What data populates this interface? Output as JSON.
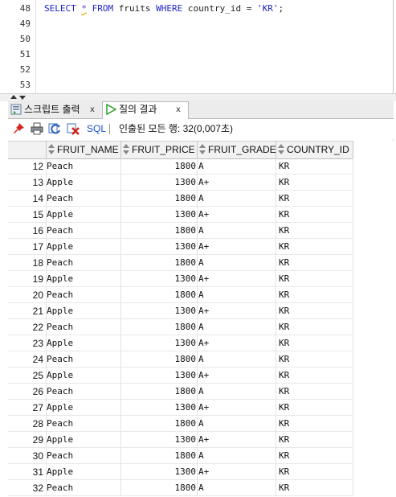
{
  "editor": {
    "line_numbers": [
      "48",
      "49",
      "50",
      "51",
      "52",
      "53"
    ],
    "code": {
      "kw_select": "SELECT",
      "star": "*",
      "kw_from": "FROM",
      "table": "fruits",
      "kw_where": "WHERE",
      "column": "country_id",
      "op": "=",
      "literal": "'KR'",
      "semicolon": ";"
    }
  },
  "tabs": [
    {
      "label": "스크립트 출력",
      "close": "x",
      "icon": "script-output-icon"
    },
    {
      "label": "질의 결과",
      "close": "x",
      "icon": "run-query-icon",
      "active": true
    }
  ],
  "toolbar": {
    "sql_label": "SQL",
    "status": "인출된 모든 행: 32(0,007초)",
    "icons": [
      "pin-icon",
      "print-icon",
      "refresh-icon",
      "clear-icon"
    ]
  },
  "grid": {
    "columns": [
      "FRUIT_NAME",
      "FRUIT_PRICE",
      "FRUIT_GRADE",
      "COUNTRY_ID"
    ],
    "rows": [
      {
        "n": "12",
        "name": "Peach",
        "price": "1800",
        "grade": "A",
        "cid": "KR"
      },
      {
        "n": "13",
        "name": "Apple",
        "price": "1300",
        "grade": "A+",
        "cid": "KR"
      },
      {
        "n": "14",
        "name": "Peach",
        "price": "1800",
        "grade": "A",
        "cid": "KR"
      },
      {
        "n": "15",
        "name": "Apple",
        "price": "1300",
        "grade": "A+",
        "cid": "KR"
      },
      {
        "n": "16",
        "name": "Peach",
        "price": "1800",
        "grade": "A",
        "cid": "KR"
      },
      {
        "n": "17",
        "name": "Apple",
        "price": "1300",
        "grade": "A+",
        "cid": "KR"
      },
      {
        "n": "18",
        "name": "Peach",
        "price": "1800",
        "grade": "A",
        "cid": "KR"
      },
      {
        "n": "19",
        "name": "Apple",
        "price": "1300",
        "grade": "A+",
        "cid": "KR"
      },
      {
        "n": "20",
        "name": "Peach",
        "price": "1800",
        "grade": "A",
        "cid": "KR"
      },
      {
        "n": "21",
        "name": "Apple",
        "price": "1300",
        "grade": "A+",
        "cid": "KR"
      },
      {
        "n": "22",
        "name": "Peach",
        "price": "1800",
        "grade": "A",
        "cid": "KR"
      },
      {
        "n": "23",
        "name": "Apple",
        "price": "1300",
        "grade": "A+",
        "cid": "KR"
      },
      {
        "n": "24",
        "name": "Peach",
        "price": "1800",
        "grade": "A",
        "cid": "KR"
      },
      {
        "n": "25",
        "name": "Apple",
        "price": "1300",
        "grade": "A+",
        "cid": "KR"
      },
      {
        "n": "26",
        "name": "Peach",
        "price": "1800",
        "grade": "A",
        "cid": "KR"
      },
      {
        "n": "27",
        "name": "Apple",
        "price": "1300",
        "grade": "A+",
        "cid": "KR"
      },
      {
        "n": "28",
        "name": "Peach",
        "price": "1800",
        "grade": "A",
        "cid": "KR"
      },
      {
        "n": "29",
        "name": "Apple",
        "price": "1300",
        "grade": "A+",
        "cid": "KR"
      },
      {
        "n": "30",
        "name": "Peach",
        "price": "1800",
        "grade": "A",
        "cid": "KR"
      },
      {
        "n": "31",
        "name": "Apple",
        "price": "1300",
        "grade": "A+",
        "cid": "KR"
      },
      {
        "n": "32",
        "name": "Peach",
        "price": "1800",
        "grade": "A",
        "cid": "KR"
      }
    ]
  },
  "colors": {
    "keyword": "#1f23c8",
    "sql_link": "#1a4fd0",
    "active_tab_icon": "#2a9d2a"
  }
}
